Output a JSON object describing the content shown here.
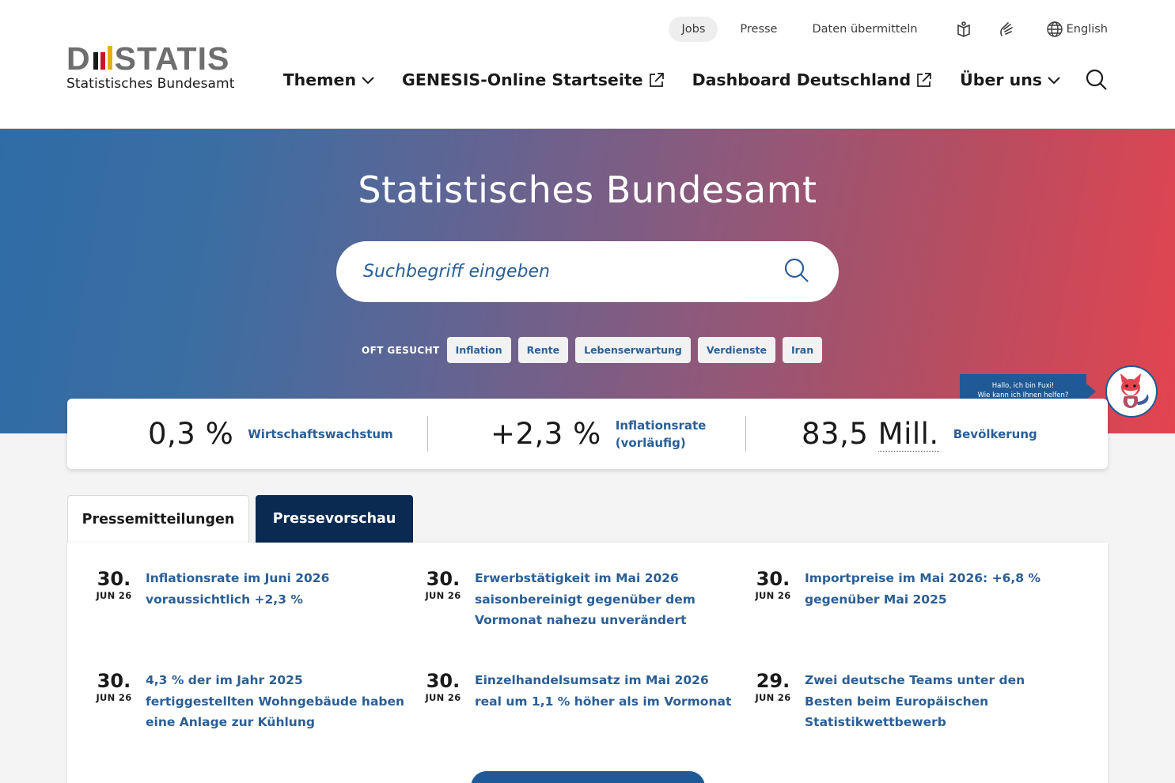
{
  "header": {
    "logo": {
      "word_left": "D",
      "word_right": "STATIS",
      "subtitle": "Statistisches Bundesamt",
      "bar_colors": [
        "#1a1a1a",
        "#c7162b",
        "#e2b30e"
      ]
    },
    "topnav": [
      {
        "label": "Jobs",
        "active": true
      },
      {
        "label": "Presse",
        "active": false
      },
      {
        "label": "Daten übermitteln",
        "active": false
      }
    ],
    "accessibility_icons": [
      "easy-language-icon",
      "sign-language-icon"
    ],
    "language": {
      "icon": "globe-icon",
      "label": "English"
    },
    "mainnav": [
      {
        "label": "Themen",
        "icon": "chevron-down-icon"
      },
      {
        "label": "GENESIS-Online Startseite",
        "icon": "external-link-icon"
      },
      {
        "label": "Dashboard Deutschland",
        "icon": "external-link-icon"
      },
      {
        "label": "Über uns",
        "icon": "chevron-down-icon"
      }
    ]
  },
  "hero": {
    "title": "Statistisches Bundesamt",
    "search": {
      "placeholder": "Suchbegriff eingeben",
      "value": ""
    },
    "often_label": "OFT GESUCHT",
    "chips": [
      "Inflation",
      "Rente",
      "Lebenserwartung",
      "Verdienste",
      "Iran"
    ],
    "gradient": {
      "from": "#2f6ca6",
      "to": "#e3444f"
    }
  },
  "chatbot": {
    "line1": "Hallo, ich bin Fuxi!",
    "line2": "Wie kann ich Ihnen helfen?",
    "icon": "fox-avatar-icon"
  },
  "stats": [
    {
      "value": "0,3 %",
      "label": "Wirtschaftswachstum"
    },
    {
      "value": "+2,3 %",
      "label_line1": "Inflationsrate",
      "label_line2": "(vorläufig)"
    },
    {
      "value_number": "83,5",
      "value_unit": "Mill.",
      "label": "Bevölkerung"
    }
  ],
  "tabs": [
    {
      "label": "Pressemitteilungen",
      "selected": false
    },
    {
      "label": "Pressevorschau",
      "selected": true
    }
  ],
  "news": [
    {
      "day": "30.",
      "month": "JUN 26",
      "title": "Inflationsrate im Juni 2026 voraussichtlich +2,3 %"
    },
    {
      "day": "30.",
      "month": "JUN 26",
      "title": "Erwerbstätigkeit im Mai 2026 saisonbereinigt gegenüber dem Vormonat nahezu unverändert"
    },
    {
      "day": "30.",
      "month": "JUN 26",
      "title": "Importpreise im Mai 2026: +6,8 % gegenüber Mai 2025"
    },
    {
      "day": "30.",
      "month": "JUN 26",
      "title": "4,3 % der im Jahr 2025 fertiggestellten Wohngebäude haben eine Anlage zur Kühlung"
    },
    {
      "day": "30.",
      "month": "JUN 26",
      "title": "Einzelhandelsumsatz im Mai 2026 real um 1,1 % höher als im Vormonat"
    },
    {
      "day": "29.",
      "month": "JUN 26",
      "title": "Zwei deutsche Teams unter den Besten beim Europäischen Statistikwettbewerb"
    }
  ],
  "colors": {
    "link": "#2b5f95",
    "dark_navy": "#0b2a52",
    "accent_blue": "#1f5a96"
  }
}
